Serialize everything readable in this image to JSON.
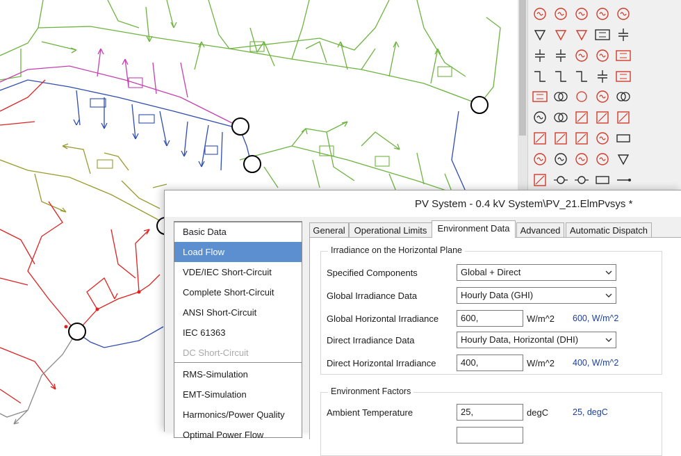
{
  "window": {
    "title": "PV System - 0.4 kV System\\PV_21.ElmPvsys *"
  },
  "nav": {
    "items": [
      {
        "label": "Basic Data",
        "state": "normal"
      },
      {
        "label": "Load Flow",
        "state": "selected"
      },
      {
        "label": "VDE/IEC Short-Circuit",
        "state": "normal"
      },
      {
        "label": "Complete Short-Circuit",
        "state": "normal"
      },
      {
        "label": "ANSI Short-Circuit",
        "state": "normal"
      },
      {
        "label": "IEC 61363",
        "state": "normal"
      },
      {
        "label": "DC Short-Circuit",
        "state": "disabled"
      },
      {
        "label": "RMS-Simulation",
        "state": "normal"
      },
      {
        "label": "EMT-Simulation",
        "state": "normal"
      },
      {
        "label": "Harmonics/Power Quality",
        "state": "normal"
      },
      {
        "label": "Optimal Power Flow",
        "state": "normal"
      }
    ]
  },
  "tabs": [
    {
      "label": "General"
    },
    {
      "label": "Operational Limits"
    },
    {
      "label": "Environment Data",
      "active": true
    },
    {
      "label": "Advanced"
    },
    {
      "label": "Automatic Dispatch"
    }
  ],
  "irradiance": {
    "group_title": "Irradiance on the Horizontal Plane",
    "specified_components": {
      "label": "Specified Components",
      "value": "Global + Direct"
    },
    "global_data": {
      "label": "Global Irradiance Data",
      "value": "Hourly Data (GHI)"
    },
    "global_horizontal": {
      "label": "Global Horizontal Irradiance",
      "value": "600,",
      "unit": "W/m^2",
      "readout": "600, W/m^2"
    },
    "direct_data": {
      "label": "Direct Irradiance Data",
      "value": "Hourly Data, Horizontal (DHI)"
    },
    "direct_horizontal": {
      "label": "Direct Horizontal Irradiance",
      "value": "400,",
      "unit": "W/m^2",
      "readout": "400, W/m^2"
    }
  },
  "environment": {
    "group_title": "Environment Factors",
    "ambient_temperature": {
      "label": "Ambient Temperature",
      "value": "25,",
      "unit": "degC",
      "readout": "25, degC"
    }
  },
  "colors": {
    "feeder_green": "#6db33f",
    "feeder_blue": "#2f4cb0",
    "feeder_olive": "#9a9a2e",
    "feeder_red": "#e02020",
    "feeder_magenta": "#c43fb0",
    "feeder_gray": "#8a8a8a",
    "symbol_red": "#d23a2a",
    "selection": "#5b8fd0",
    "readout_blue": "#1c3f9a"
  },
  "palette": {
    "icons": [
      "voltage-source-icon",
      "current-source-icon",
      "ac-source-icon",
      "ac-source-icon",
      "ac-dc-source-icon",
      "load-triangle-icon",
      "mv-load-icon",
      "lv-load-icon",
      "unknown-load-icon",
      "ground-icon",
      "capacitor-icon",
      "shunt-icon",
      "generator-icon",
      "static-generator-icon",
      "svs-icon",
      "switch-icon",
      "fuse-icon",
      "breaker-icon",
      "capacitor-icon",
      "rlc-icon",
      "impedance-icon",
      "transformer-icon",
      "surge-arrester-icon",
      "motor-icon",
      "three-winding-transformer-icon",
      "synchronous-machine-icon",
      "loop-icon",
      "pv-icon",
      "pv-icon",
      "pv-icon",
      "pv-icon",
      "pv-icon",
      "inverter-icon",
      "motor-icon",
      "busbar-icon",
      "dc-source-icon",
      "voltage-meter-icon",
      "measurement-icon",
      "measurement-icon",
      "load-triangle-icon",
      "filter-icon",
      "terminal-icon",
      "node-icon",
      "rectangle-icon",
      "line-icon"
    ]
  }
}
